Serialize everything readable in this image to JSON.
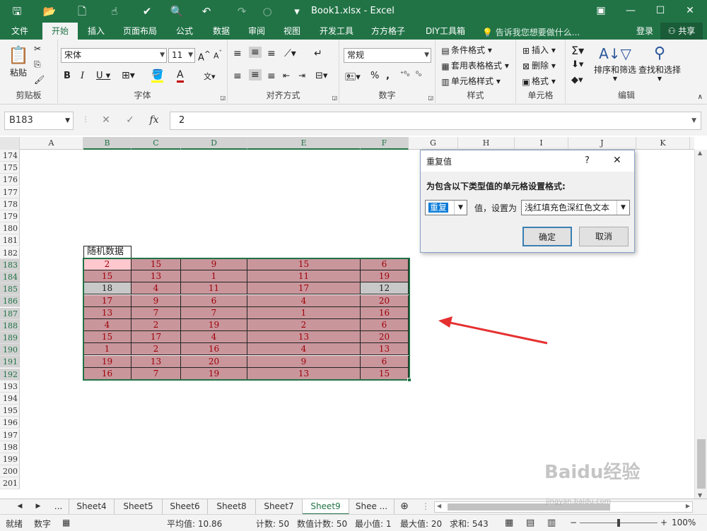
{
  "window": {
    "title": "Book1.xlsx - Excel"
  },
  "menu": {
    "tabs": [
      "文件",
      "开始",
      "插入",
      "页面布局",
      "公式",
      "数据",
      "审阅",
      "视图",
      "开发工具",
      "方方格子",
      "DIY工具箱"
    ],
    "tellme": "告诉我您想要做什么...",
    "login": "登录",
    "share": "共享"
  },
  "ribbon": {
    "clipboard": {
      "label": "剪贴板",
      "paste": "粘贴"
    },
    "font": {
      "label": "字体",
      "name": "宋体",
      "size": "11"
    },
    "align": {
      "label": "对齐方式"
    },
    "number": {
      "label": "数字",
      "format": "常规"
    },
    "styles": {
      "label": "样式",
      "cond": "条件格式",
      "table": "套用表格格式",
      "cell": "单元格样式"
    },
    "cells": {
      "label": "单元格",
      "insert": "插入",
      "delete": "删除",
      "format": "格式"
    },
    "edit": {
      "label": "编辑",
      "sort": "排序和筛选",
      "find": "查找和选择"
    }
  },
  "formula": {
    "namebox": "B183",
    "value": "2"
  },
  "columns": [
    "A",
    "B",
    "C",
    "D",
    "E",
    "F",
    "G",
    "H",
    "I",
    "J",
    "K"
  ],
  "rows": [
    "174",
    "175",
    "176",
    "177",
    "178",
    "179",
    "180",
    "181",
    "182",
    "183",
    "184",
    "185",
    "186",
    "187",
    "188",
    "189",
    "190",
    "191",
    "192",
    "193",
    "194",
    "195",
    "196",
    "197",
    "198",
    "199",
    "200",
    "201"
  ],
  "table": {
    "header": "随机数据",
    "data": [
      [
        2,
        15,
        9,
        15,
        6
      ],
      [
        15,
        13,
        1,
        11,
        19
      ],
      [
        18,
        4,
        11,
        17,
        12
      ],
      [
        17,
        9,
        6,
        4,
        20
      ],
      [
        13,
        7,
        7,
        1,
        16
      ],
      [
        4,
        2,
        19,
        2,
        6
      ],
      [
        15,
        17,
        4,
        13,
        20
      ],
      [
        1,
        2,
        16,
        4,
        13
      ],
      [
        19,
        13,
        20,
        9,
        6
      ],
      [
        16,
        7,
        19,
        13,
        15
      ]
    ]
  },
  "dialog": {
    "title": "重复值",
    "help": "?",
    "close": "✕",
    "prompt": "为包含以下类型值的单元格设置格式:",
    "type": "重复",
    "mid": "值，设置为",
    "format": "浅红填充色深红色文本",
    "ok": "确定",
    "cancel": "取消"
  },
  "sheets": [
    "...",
    "Sheet4",
    "Sheet5",
    "Sheet6",
    "Sheet8",
    "Sheet7",
    "Sheet9",
    "Shee ..."
  ],
  "status": {
    "mode": "就绪",
    "num": "数字",
    "avg": "平均值: 10.86",
    "count": "计数: 50",
    "ncount": "数值计数: 50",
    "min": "最小值: 1",
    "max": "最大值: 20",
    "sum": "求和: 543",
    "zoom": "100%"
  },
  "watermark": {
    "line1": "Baidu经验",
    "line2": "jingyan.baidu.com"
  },
  "colors": {
    "excel_green": "#217346",
    "dup_fill": "#ffc7ce",
    "dup_text": "#9c0006"
  }
}
